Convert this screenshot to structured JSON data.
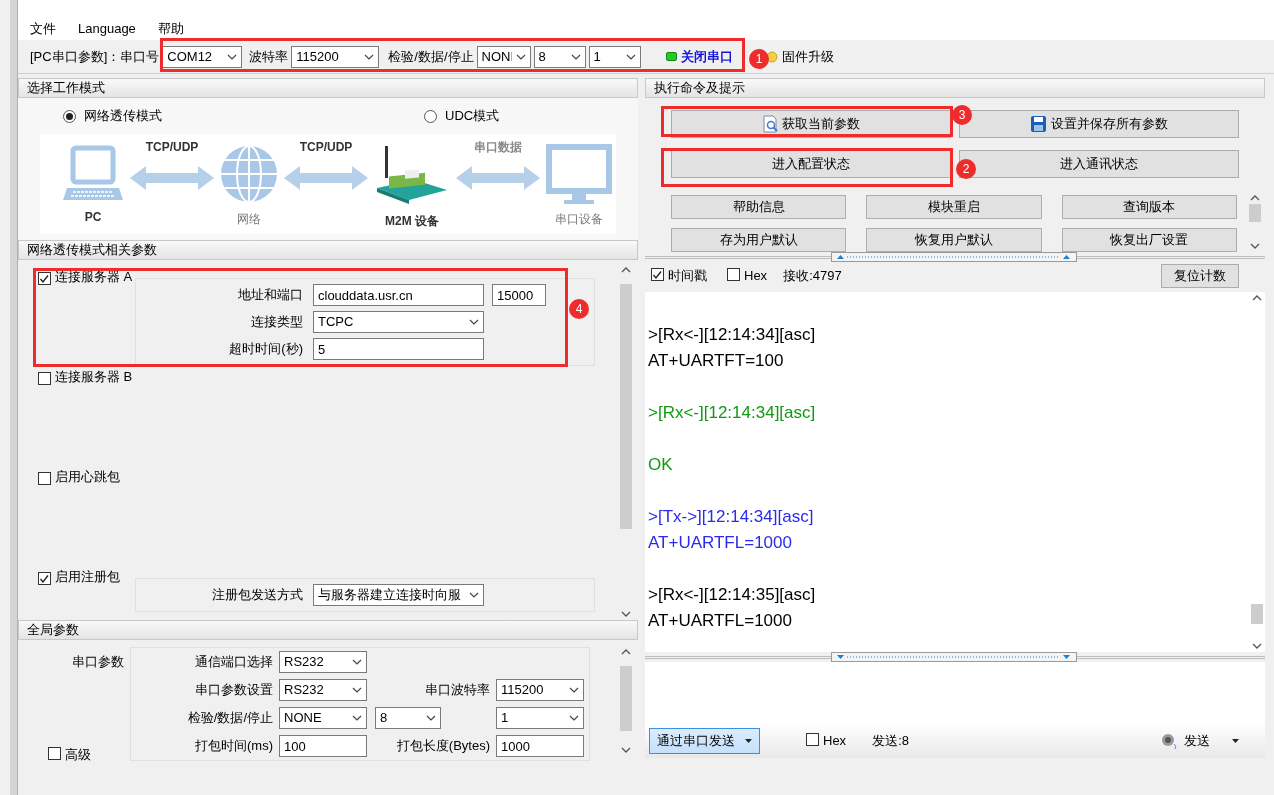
{
  "menu": [
    "文件",
    "Language",
    "帮助"
  ],
  "toolbar": {
    "port_label": "[PC串口参数]：串口号",
    "port": "COM12",
    "baud_label": "波特率",
    "baud": "115200",
    "parity_label": "检验/数据/停止",
    "parity": "NONI",
    "data_bits": "8",
    "stop_bits": "1",
    "close_button": "关闭串口",
    "port_open": true,
    "firmware_button": "固件升级"
  },
  "work_mode": {
    "title": "选择工作模式",
    "modes": [
      {
        "label": "网络透传模式",
        "selected": true
      },
      {
        "label": "UDC模式",
        "selected": false
      }
    ],
    "diagram": {
      "nodes": [
        "PC",
        "网络",
        "M2M 设备",
        "串口设备"
      ],
      "links": [
        "TCP/UDP",
        "TCP/UDP",
        "串口数据"
      ]
    }
  },
  "network_params": {
    "title": "网络透传模式相关参数",
    "sections": [
      {
        "label": "连接服务器 A",
        "checked": true,
        "fields": [
          {
            "kind": "address",
            "label": "地址和端口",
            "value": "clouddata.usr.cn",
            "port": "15000"
          },
          {
            "kind": "select",
            "label": "连接类型",
            "value": "TCPC"
          },
          {
            "kind": "text",
            "label": "超时时间(秒)",
            "value": "5"
          }
        ]
      },
      {
        "label": "连接服务器 B",
        "checked": false
      },
      {
        "label": "启用心跳包",
        "checked": false
      },
      {
        "label": "启用注册包",
        "checked": true,
        "fields": [
          {
            "kind": "select",
            "label": "注册包发送方式",
            "value": "与服务器建立连接时向服"
          }
        ]
      }
    ]
  },
  "global_params": {
    "title": "全局参数",
    "group_label": "串口参数",
    "rows": [
      [
        {
          "kind": "select",
          "label": "通信端口选择",
          "value": "RS232"
        }
      ],
      [
        {
          "kind": "select",
          "label": "串口参数设置",
          "value": "RS232"
        },
        {
          "kind": "select",
          "label": "串口波特率",
          "value": "115200"
        }
      ],
      [
        {
          "kind": "select",
          "label": "检验/数据/停止",
          "value": "NONE"
        },
        {
          "kind": "select",
          "value": "8"
        },
        {
          "kind": "select",
          "value": "1"
        }
      ],
      [
        {
          "kind": "text",
          "label": "打包时间(ms)",
          "value": "100"
        },
        {
          "kind": "text",
          "label": "打包长度(Bytes)",
          "value": "1000"
        }
      ]
    ],
    "advanced": {
      "label": "高级",
      "checked": false
    }
  },
  "commands": {
    "title": "执行命令及提示",
    "primary_buttons": [
      {
        "kind": "query",
        "label": "获取当前参数"
      },
      {
        "kind": "save",
        "label": "设置并保存所有参数"
      },
      {
        "kind": "plain",
        "label": "进入配置状态"
      },
      {
        "kind": "plain",
        "label": "进入通讯状态"
      }
    ],
    "buttons": [
      "帮助信息",
      "模块重启",
      "查询版本",
      "存为用户默认",
      "恢复用户默认",
      "恢复出厂设置"
    ]
  },
  "receive": {
    "timestamp": {
      "label": "时间戳",
      "checked": true
    },
    "hex": {
      "label": "Hex",
      "checked": false
    },
    "count": "接收:4797",
    "reset_button": "复位计数"
  },
  "log": [
    {
      "color": "#000000",
      "lines": [
        ">[Rx<-][12:14:34][asc]",
        "AT+UARTFT=100"
      ]
    },
    {
      "color": "#119911",
      "lines": [
        ">[Rx<-][12:14:34][asc]"
      ]
    },
    {
      "color": "#119911",
      "lines": [
        "OK"
      ]
    },
    {
      "color": "#2a2aee",
      "lines": [
        ">[Tx->][12:14:34][asc]",
        "AT+UARTFL=1000"
      ]
    },
    {
      "color": "#000000",
      "lines": [
        ">[Rx<-][12:14:35][asc]",
        "AT+UARTFL=1000"
      ]
    }
  ],
  "send": {
    "mode_button": "通过串口发送",
    "hex": {
      "label": "Hex",
      "checked": false
    },
    "count": "发送:8",
    "send_button": "发送"
  },
  "annotations": [
    "1",
    "2",
    "3",
    "4"
  ]
}
